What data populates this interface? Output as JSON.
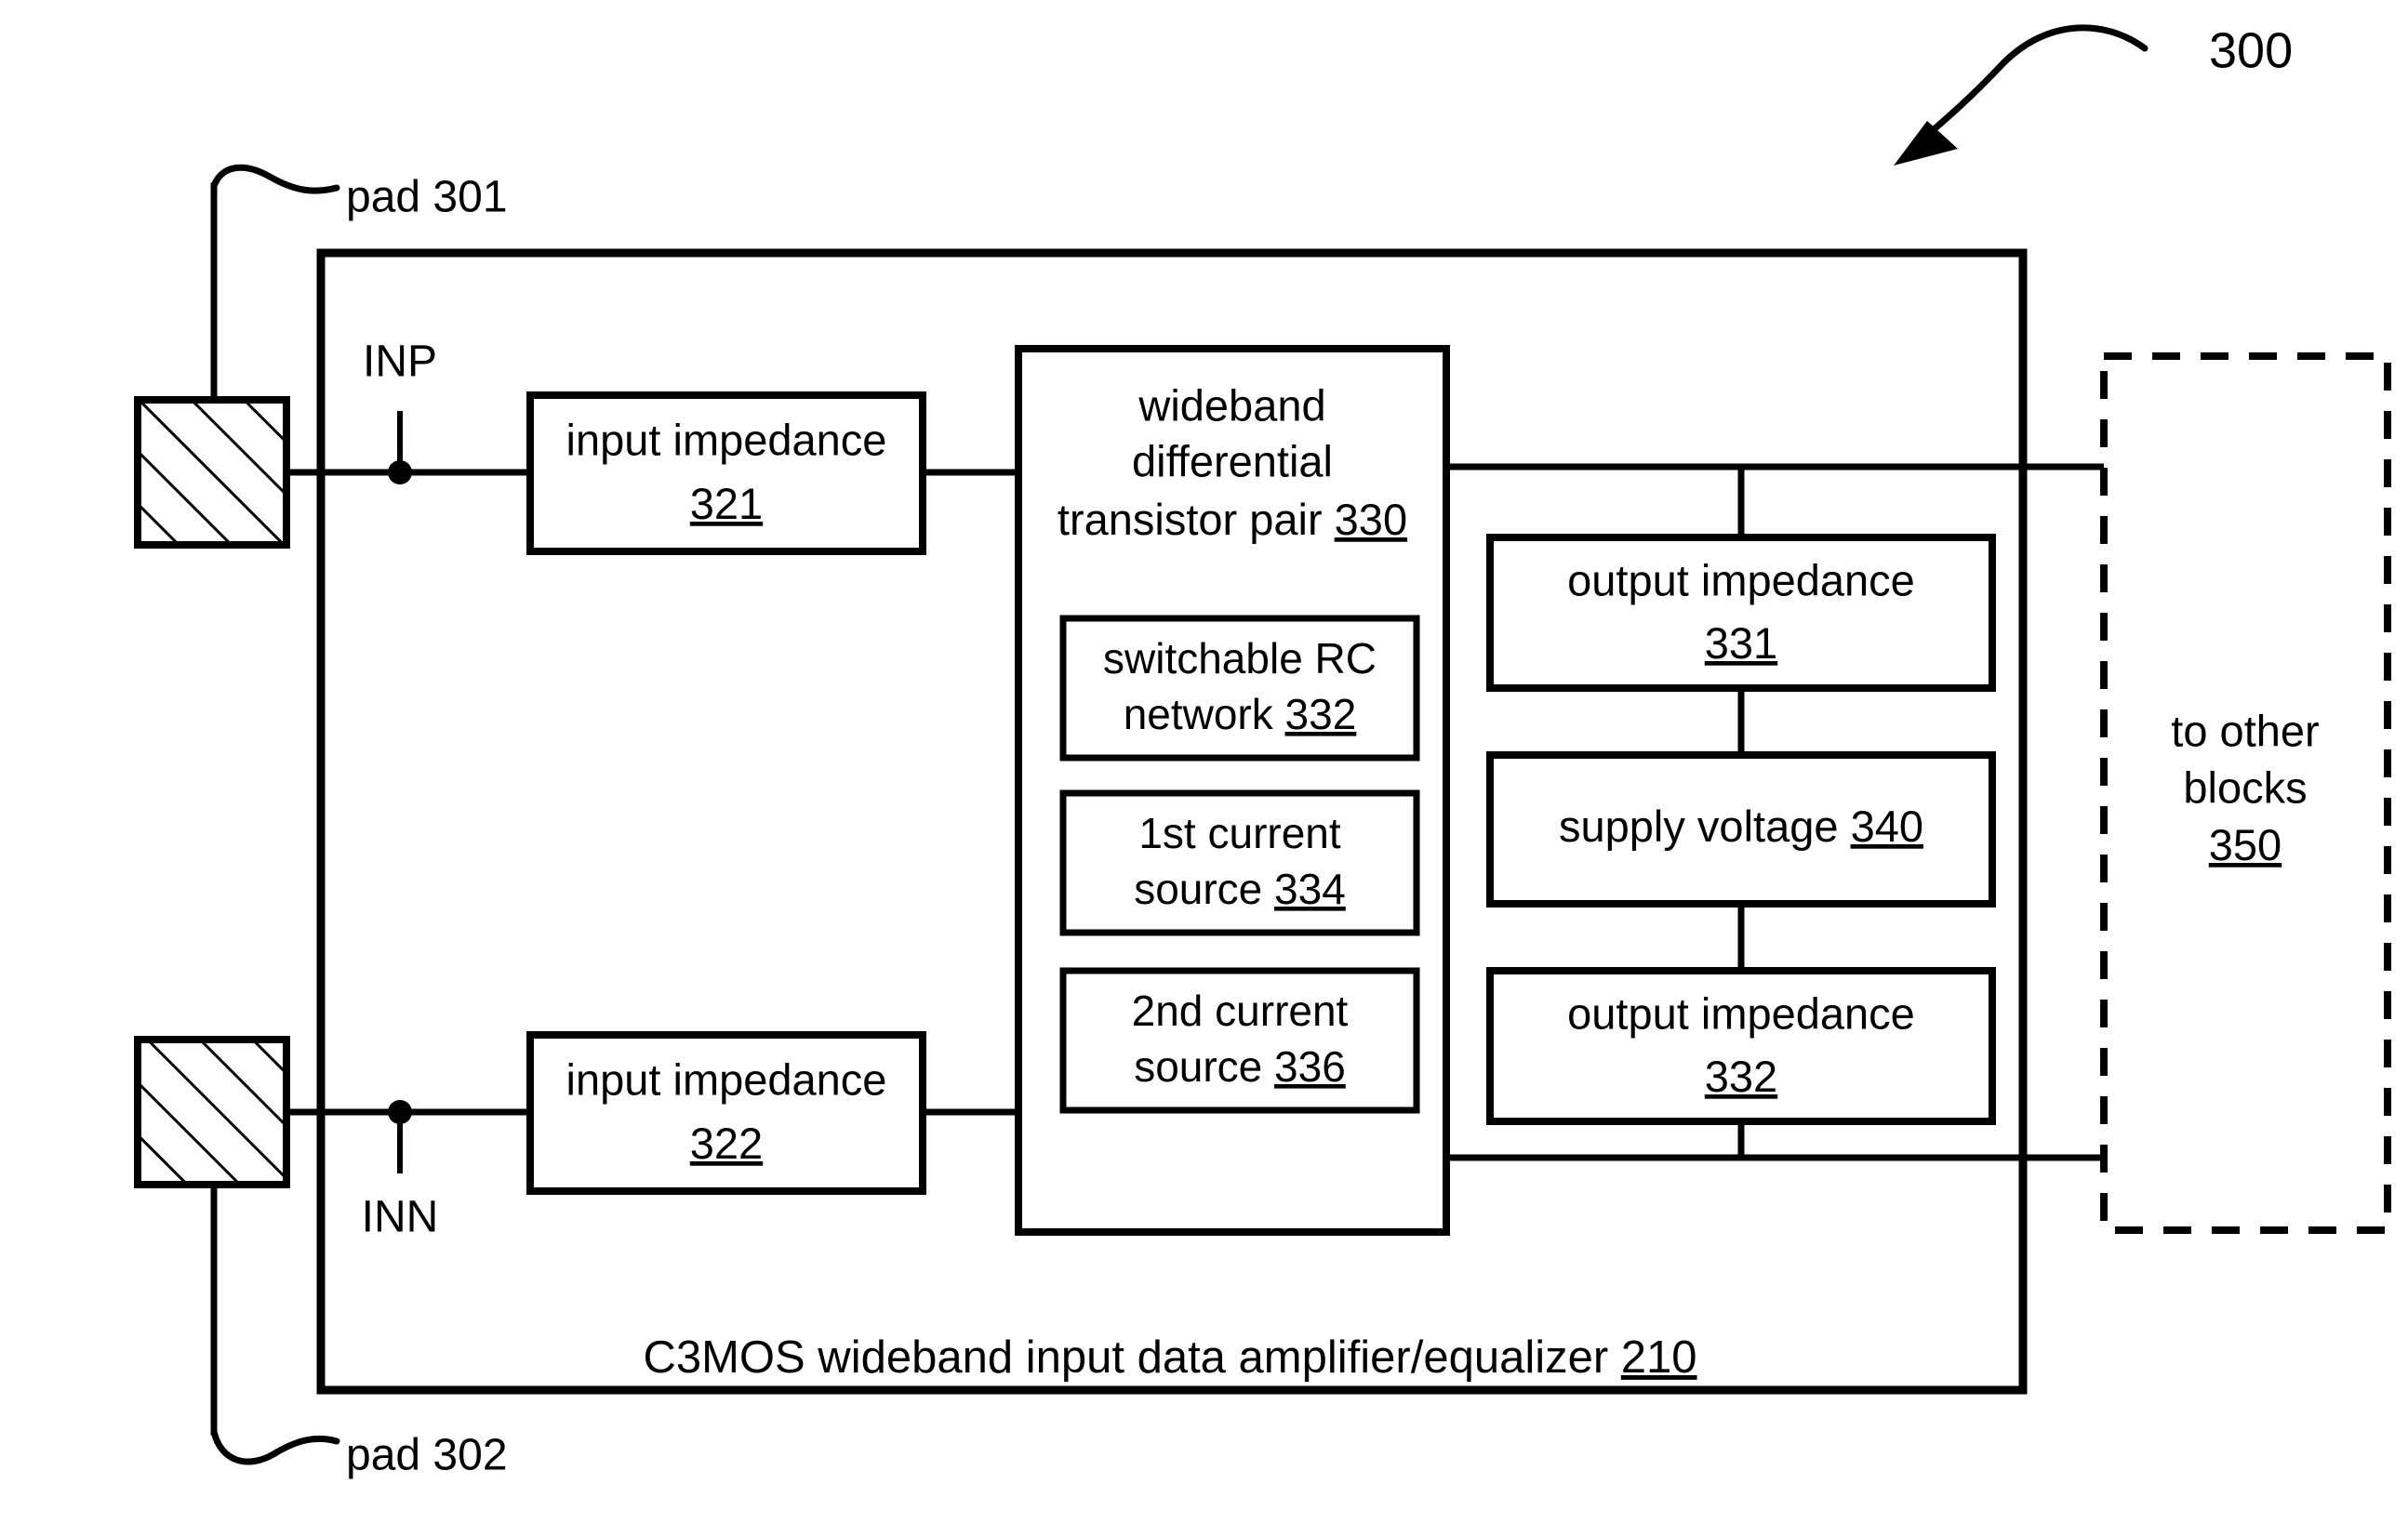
{
  "figure": {
    "reference_numeral": "300",
    "pads": [
      {
        "label": "pad 301"
      },
      {
        "label": "pad 302"
      }
    ],
    "ports": [
      {
        "label": "INP"
      },
      {
        "label": "INN"
      }
    ],
    "outer_block": {
      "caption_text": "C3MOS wideband input data amplifier/equalizer ",
      "caption_ref": "210"
    },
    "input_impedance_top": {
      "line1": "input impedance",
      "ref": "321"
    },
    "input_impedance_bottom": {
      "line1": "input impedance",
      "ref": "322"
    },
    "transistor_pair": {
      "line1": "wideband",
      "line2": "differential",
      "line3": "transistor pair ",
      "ref": "330"
    },
    "switchable_rc": {
      "line1": "switchable RC",
      "line2": "network ",
      "ref": "332"
    },
    "first_current_source": {
      "line1": "1st current",
      "line2": "source ",
      "ref": "334"
    },
    "second_current_source": {
      "line1": "2nd current",
      "line2": "source ",
      "ref": "336"
    },
    "output_impedance_top": {
      "line1": "output impedance",
      "ref": "331"
    },
    "supply_voltage": {
      "line1": "supply voltage ",
      "ref": "340"
    },
    "output_impedance_bottom": {
      "line1": "output impedance",
      "ref": "332"
    },
    "other_blocks": {
      "line1": "to other",
      "line2": "blocks",
      "ref": "350"
    },
    "colors": {
      "ink": "#000000",
      "paper": "#ffffff"
    }
  }
}
